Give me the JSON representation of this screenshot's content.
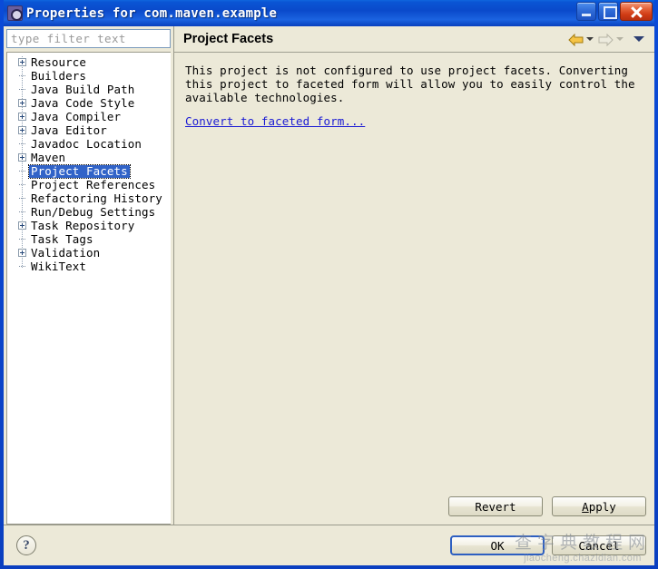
{
  "window": {
    "title": "Properties for com.maven.example",
    "icon": "properties-gear-icon",
    "minimize_label": "",
    "maximize_label": "",
    "close_label": ""
  },
  "filter": {
    "placeholder": "type filter text",
    "value": ""
  },
  "tree": {
    "items": [
      {
        "label": "Resource",
        "expandable": true,
        "selected": false
      },
      {
        "label": "Builders",
        "expandable": false,
        "selected": false
      },
      {
        "label": "Java Build Path",
        "expandable": false,
        "selected": false
      },
      {
        "label": "Java Code Style",
        "expandable": true,
        "selected": false
      },
      {
        "label": "Java Compiler",
        "expandable": true,
        "selected": false
      },
      {
        "label": "Java Editor",
        "expandable": true,
        "selected": false
      },
      {
        "label": "Javadoc Location",
        "expandable": false,
        "selected": false
      },
      {
        "label": "Maven",
        "expandable": true,
        "selected": false
      },
      {
        "label": "Project Facets",
        "expandable": false,
        "selected": true
      },
      {
        "label": "Project References",
        "expandable": false,
        "selected": false
      },
      {
        "label": "Refactoring History",
        "expandable": false,
        "selected": false
      },
      {
        "label": "Run/Debug Settings",
        "expandable": false,
        "selected": false
      },
      {
        "label": "Task Repository",
        "expandable": true,
        "selected": false
      },
      {
        "label": "Task Tags",
        "expandable": false,
        "selected": false
      },
      {
        "label": "Validation",
        "expandable": true,
        "selected": false
      },
      {
        "label": "WikiText",
        "expandable": false,
        "selected": false
      }
    ]
  },
  "page": {
    "title": "Project Facets",
    "nav": {
      "back_icon": "back-arrow-icon",
      "back_menu_icon": "chevron-down-icon",
      "forward_icon": "forward-arrow-icon",
      "forward_menu_icon": "chevron-down-icon",
      "view_menu_icon": "chevron-down-icon"
    },
    "description": "This project is not configured to use project facets. Converting this project to faceted form will allow you to easily control the available technologies.",
    "convert_link": "Convert to faceted form..."
  },
  "buttons": {
    "revert": "Revert",
    "apply_prefix": "",
    "apply_accel": "A",
    "apply_rest": "pply",
    "ok": "OK",
    "cancel": "Cancel"
  },
  "footer": {
    "help_icon": "help-question-icon",
    "help_glyph": "?"
  },
  "watermark": {
    "cn": "查字典教程网",
    "en": "jiaocheng.chazidian.com"
  },
  "colors": {
    "title_bar_blue": "#0A4ACB",
    "dialog_bg": "#ECE9D8",
    "tree_bg": "#FFFFFF",
    "selection_blue": "#3163C8",
    "link_blue": "#1A1AD4",
    "close_red": "#CF3A14"
  }
}
